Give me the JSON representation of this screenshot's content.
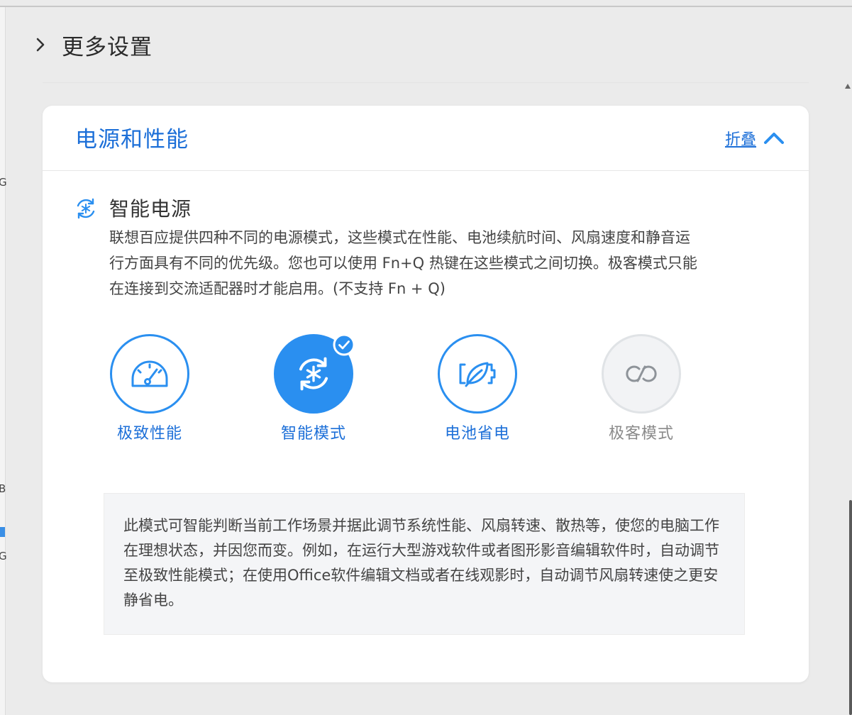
{
  "more_settings": {
    "label": "更多设置"
  },
  "panel": {
    "title": "电源和性能",
    "collapse_label": "折叠"
  },
  "smart_power": {
    "title": "智能电源",
    "description": "联想百应提供四种不同的电源模式，这些模式在性能、电池续航时间、风扇速度和静音运行方面具有不同的优先级。您也可以使用 Fn+Q 热键在这些模式之间切换。极客模式只能在连接到交流适配器时才能启用。(不支持 Fn + Q)"
  },
  "modes": [
    {
      "label": "极致性能",
      "icon": "speedometer-icon",
      "state": "available"
    },
    {
      "label": "智能模式",
      "icon": "smart-fan-icon",
      "state": "selected"
    },
    {
      "label": "电池省电",
      "icon": "leaf-battery-icon",
      "state": "available"
    },
    {
      "label": "极客模式",
      "icon": "infinity-icon",
      "state": "disabled"
    }
  ],
  "mode_info": "此模式可智能判断当前工作场景并据此调节系统性能、风扇转速、散热等，使您的电脑工作在理想状态，并因您而变。例如，在运行大型游戏软件或者图形影音编辑软件时，自动调节至极致性能模式；在使用Office软件编辑文档或者在线观影时，自动调节风扇转速使之更安静省电。",
  "colors": {
    "accent": "#2a8ff0",
    "title_blue": "#1c6fd8",
    "disabled_border": "#e0e3e6",
    "info_bg": "#f4f5f7"
  }
}
